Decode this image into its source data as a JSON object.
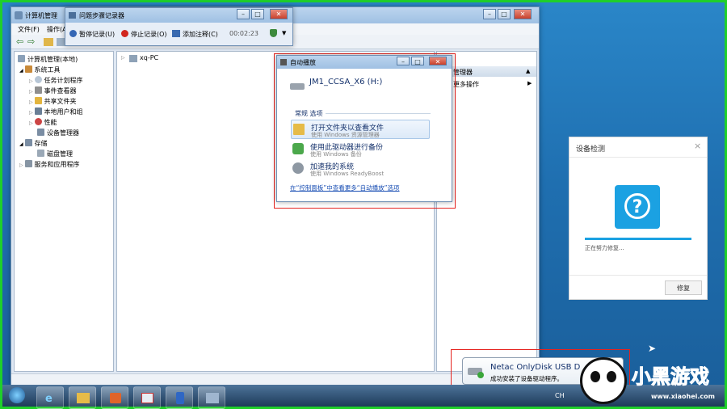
{
  "mmc": {
    "title": "计算机管理",
    "menu": [
      "文件(F)",
      "操作(A)"
    ],
    "tree": [
      {
        "label": "计算机管理(本地)",
        "icon": "computer-icon"
      },
      {
        "label": "系统工具",
        "icon": "tools-icon"
      },
      {
        "label": "任务计划程序",
        "icon": "clock-icon"
      },
      {
        "label": "事件查看器",
        "icon": "event-viewer-icon"
      },
      {
        "label": "共享文件夹",
        "icon": "shared-folder-icon"
      },
      {
        "label": "本地用户和组",
        "icon": "users-icon"
      },
      {
        "label": "性能",
        "icon": "performance-icon"
      },
      {
        "label": "设备管理器",
        "icon": "device-manager-icon"
      },
      {
        "label": "存储",
        "icon": "storage-icon"
      },
      {
        "label": "磁盘管理",
        "icon": "disk-icon"
      },
      {
        "label": "服务和应用程序",
        "icon": "services-icon"
      }
    ],
    "center_root": "xq-PC",
    "actions_header": "管理器",
    "actions_more": "更多操作"
  },
  "recorder": {
    "title": "问题步骤记录器",
    "pause": "暂停记录(U)",
    "stop": "停止记录(O)",
    "comment": "添加注释(C)",
    "timer": "00:02:23"
  },
  "autoplay": {
    "title": "自动播放",
    "drive": "JM1_CCSA_X6 (H:)",
    "section": "常规 选项",
    "options": [
      {
        "title": "打开文件夹以查看文件",
        "sub": "使用 Windows 资源管理器"
      },
      {
        "title": "使用此驱动器进行备份",
        "sub": "使用 Windows 备份"
      },
      {
        "title": "加速我的系统",
        "sub": "使用 Windows ReadyBoost"
      }
    ],
    "link": "在“控制面板”中查看更多“自动播放”选项"
  },
  "device_check": {
    "title": "设备检测",
    "close": "×",
    "status": "正在努力修复...",
    "progress": 1.0,
    "button": "修复"
  },
  "notification": {
    "title": "Netac OnlyDisk USB D",
    "body": "成功安装了设备驱动程序。"
  },
  "taskbar": {
    "lang": "CH"
  },
  "watermark": {
    "text": "小黑游戏",
    "url": "www.xiaohei.com"
  },
  "colors": {
    "border_green": "#1fcf2a",
    "highlight_red": "#e5231f",
    "accent_blue": "#1ba1e2"
  }
}
